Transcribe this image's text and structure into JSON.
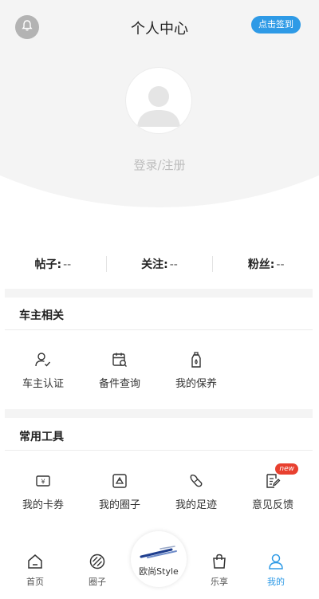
{
  "header": {
    "title": "个人中心",
    "signin_label": "点击签到",
    "login_label": "登录/注册",
    "bell_icon": "bell-icon",
    "avatar_icon": "default-avatar"
  },
  "stats": [
    {
      "label": "帖子:",
      "value": "--"
    },
    {
      "label": "关注:",
      "value": "--"
    },
    {
      "label": "粉丝:",
      "value": "--"
    }
  ],
  "owner_section": {
    "title": "车主相关",
    "items": [
      {
        "label": "车主认证",
        "icon": "user-check-icon"
      },
      {
        "label": "备件查询",
        "icon": "parts-search-icon"
      },
      {
        "label": "我的保养",
        "icon": "maintenance-bottle-icon"
      }
    ]
  },
  "tools_section": {
    "title": "常用工具",
    "items": [
      {
        "label": "我的卡券",
        "icon": "coupon-icon"
      },
      {
        "label": "我的圈子",
        "icon": "circle-icon"
      },
      {
        "label": "我的足迹",
        "icon": "footprint-icon"
      },
      {
        "label": "意见反馈",
        "icon": "feedback-icon",
        "badge": "new"
      }
    ]
  },
  "tabbar": {
    "tabs": [
      {
        "label": "首页",
        "icon": "home-icon"
      },
      {
        "label": "圈子",
        "icon": "compass-icon"
      },
      {
        "label": "欧尚Style",
        "icon": "brand-logo"
      },
      {
        "label": "乐享",
        "icon": "bag-icon"
      },
      {
        "label": "我的",
        "icon": "person-icon",
        "active": true
      }
    ]
  },
  "colors": {
    "accent": "#2e9ae6",
    "badge": "#e8402f",
    "gray_bg": "#f4f4f4"
  }
}
